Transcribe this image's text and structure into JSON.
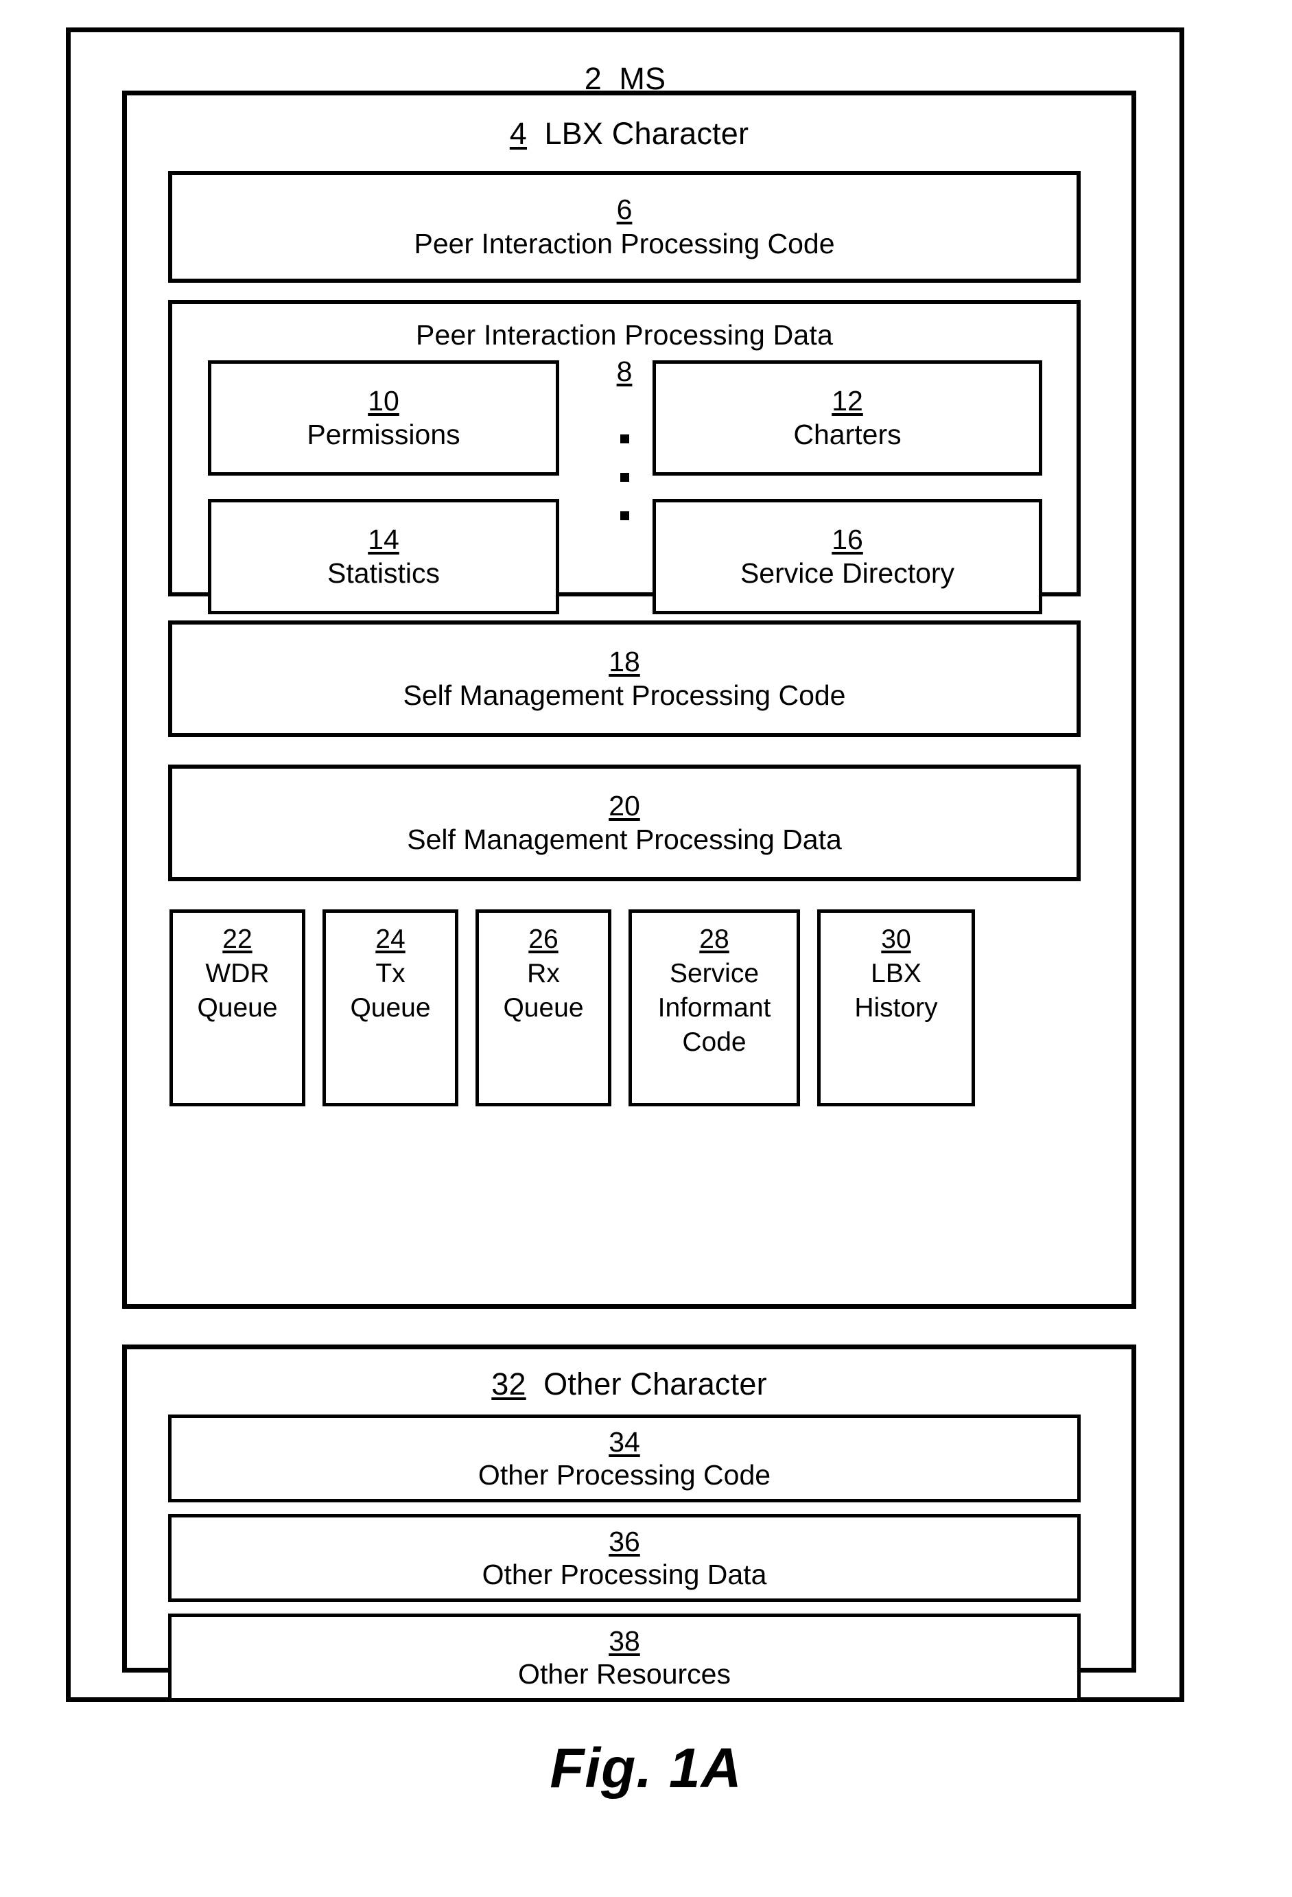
{
  "figure": {
    "caption": "Fig. 1A"
  },
  "ms": {
    "ref": "2",
    "label": "MS"
  },
  "lbx_character": {
    "ref": "4",
    "label": "LBX Character",
    "peer_interaction_processing_code": {
      "ref": "6",
      "label": "Peer Interaction Processing Code"
    },
    "peer_interaction_processing_data": {
      "ref": "8",
      "label": "Peer Interaction Processing Data",
      "items": [
        {
          "ref": "10",
          "label": "Permissions"
        },
        {
          "ref": "12",
          "label": "Charters"
        },
        {
          "ref": "14",
          "label": "Statistics"
        },
        {
          "ref": "16",
          "label": "Service Directory"
        }
      ],
      "ellipsis_dots": 3
    },
    "self_management_processing_code": {
      "ref": "18",
      "label": "Self Management Processing Code"
    },
    "self_management_processing_data": {
      "ref": "20",
      "label": "Self Management Processing Data"
    },
    "queues": [
      {
        "ref": "22",
        "line1": "WDR",
        "line2": "Queue",
        "line3": ""
      },
      {
        "ref": "24",
        "line1": "Tx",
        "line2": "Queue",
        "line3": ""
      },
      {
        "ref": "26",
        "line1": "Rx",
        "line2": "Queue",
        "line3": ""
      },
      {
        "ref": "28",
        "line1": "Service",
        "line2": "Informant",
        "line3": "Code"
      },
      {
        "ref": "30",
        "line1": "LBX",
        "line2": "History",
        "line3": ""
      }
    ]
  },
  "other_character": {
    "ref": "32",
    "label": "Other Character",
    "items": [
      {
        "ref": "34",
        "label": "Other Processing Code"
      },
      {
        "ref": "36",
        "label": "Other Processing Data"
      },
      {
        "ref": "38",
        "label": "Other Resources"
      }
    ]
  }
}
